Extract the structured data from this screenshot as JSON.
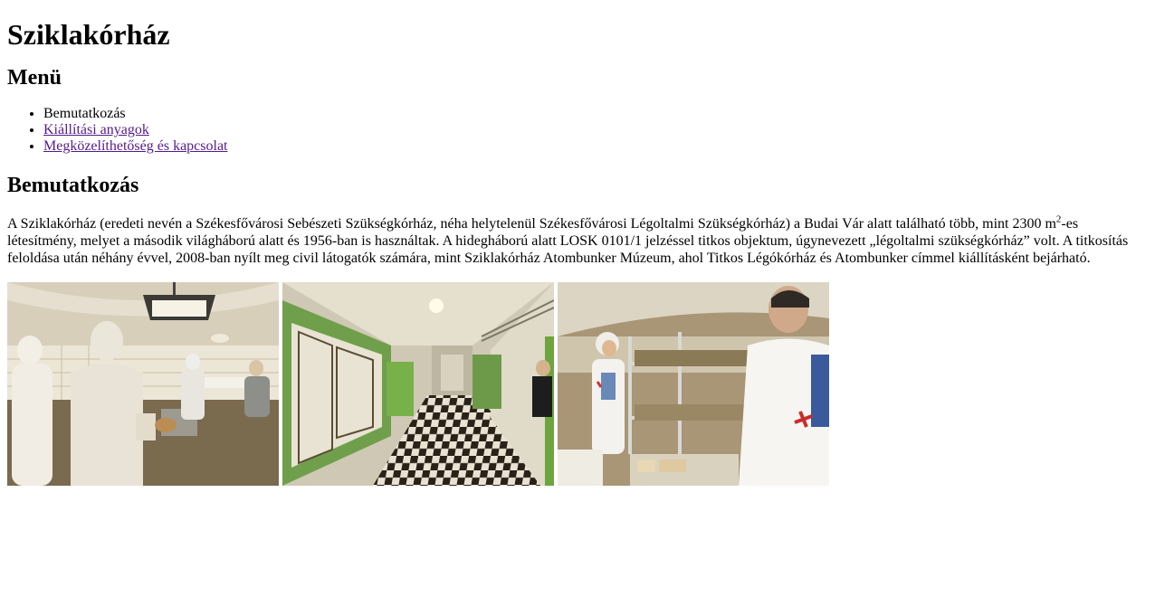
{
  "title": "Sziklakórház",
  "menu": {
    "heading": "Menü",
    "items": [
      {
        "label": "Bemutatkozás",
        "link": false
      },
      {
        "label": "Kiállítási anyagok",
        "link": true
      },
      {
        "label": "Megközelíthetőség és kapcsolat",
        "link": true
      }
    ]
  },
  "section": {
    "heading": "Bemutatkozás",
    "text_before_sup": "A Sziklakórház (eredeti nevén a Székesfővárosi Sebészeti Szükségkórház, néha helytelenül Székesfővárosi Légoltalmi Szükségkórház) a Budai Vár alatt található több, mint 2300 m",
    "sup": "2",
    "text_after_sup": "-es létesítmény, melyet a második világháború alatt és 1956-ban is használtak. A hidegháború alatt LOSK 0101/1 jelzéssel titkos objektum, úgynevezett „légoltalmi szükségkórház” volt. A titkosítás feloldása után néhány évvel, 2008-ban nyílt meg civil látogatók számára, mint Sziklakórház Atombunker Múzeum, ahol Titkos Légókórház és Atombunker címmel kiállításként bejárható."
  },
  "gallery": {
    "photos": [
      {
        "name": "operating-room-photo"
      },
      {
        "name": "corridor-photo"
      },
      {
        "name": "ward-photo"
      }
    ]
  },
  "colors": {
    "link": "#551a8b",
    "text": "#000000",
    "background": "#ffffff"
  }
}
